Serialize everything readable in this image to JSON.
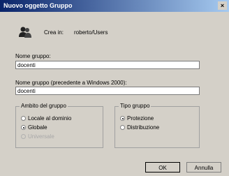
{
  "window": {
    "title": "Nuovo oggetto Gruppo",
    "close_glyph": "×"
  },
  "create_in": {
    "label": "Crea in:",
    "value": "roberto/Users",
    "icon": "group-icon"
  },
  "group_name": {
    "label": "Nome gruppo:",
    "value": "docenti"
  },
  "group_name_pre2000": {
    "label": "Nome gruppo (precedente a Windows 2000):",
    "value": "docenti"
  },
  "scope": {
    "title": "Ambito del gruppo",
    "options": [
      {
        "label": "Locale al dominio",
        "checked": false,
        "disabled": false
      },
      {
        "label": "Globale",
        "checked": true,
        "disabled": false
      },
      {
        "label": "Universale",
        "checked": false,
        "disabled": true
      }
    ]
  },
  "type": {
    "title": "Tipo gruppo",
    "options": [
      {
        "label": "Protezione",
        "checked": true,
        "disabled": false
      },
      {
        "label": "Distribuzione",
        "checked": false,
        "disabled": false
      }
    ]
  },
  "buttons": {
    "ok": "OK",
    "cancel": "Annulla"
  }
}
